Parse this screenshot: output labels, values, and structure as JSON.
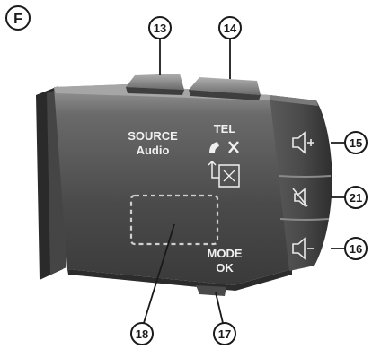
{
  "figure": {
    "label": "F"
  },
  "callouts": {
    "c13": "13",
    "c14": "14",
    "c15": "15",
    "c16": "16",
    "c17": "17",
    "c18": "18",
    "c21": "21"
  },
  "labels": {
    "source": "SOURCE",
    "audio": "Audio",
    "tel": "TEL",
    "mode": "MODE",
    "ok": "OK"
  },
  "icons": {
    "phone": "phone-icon",
    "volume_up": "speaker-plus-icon",
    "mute": "speaker-mute-icon",
    "volume_down": "speaker-minus-icon",
    "display_select": "display-select-icon"
  },
  "colors": {
    "body_dark": "#3a3a3a",
    "body_mid": "#5a5a5a",
    "body_light": "#8a8a8a",
    "highlight": "#b5b5b5",
    "text_on_body": "#f0f0f0",
    "ink": "#1a1a1a"
  }
}
